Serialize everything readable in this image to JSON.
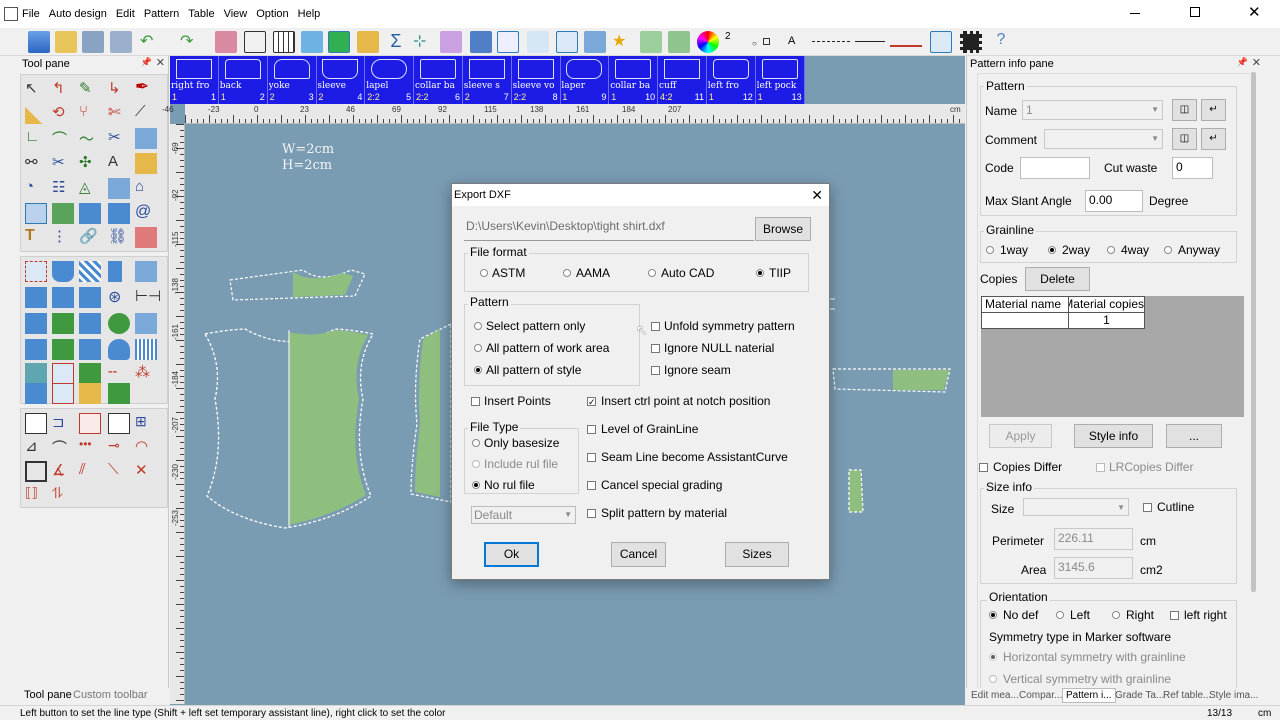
{
  "menu": [
    "File",
    "Auto design",
    "Edit",
    "Pattern",
    "Table",
    "View",
    "Option",
    "Help"
  ],
  "toolbar": {
    "layer_value": "2",
    "A_label": "A"
  },
  "tool_pane": {
    "title": "Tool pane",
    "tabs": [
      "Tool pane",
      "Custom toolbar"
    ]
  },
  "pieces": [
    {
      "name": "right fro",
      "count": "1",
      "num": "1"
    },
    {
      "name": "back",
      "count": "1",
      "num": "2"
    },
    {
      "name": "yoke",
      "count": "2",
      "num": "3"
    },
    {
      "name": "sleeve",
      "count": "2",
      "num": "4"
    },
    {
      "name": "lapel",
      "count": "2:2",
      "num": "5"
    },
    {
      "name": "collar ba",
      "count": "2:2",
      "num": "6"
    },
    {
      "name": "sleeve s",
      "count": "2",
      "num": "7"
    },
    {
      "name": "sleeve vo",
      "count": "2:2",
      "num": "8"
    },
    {
      "name": "laper",
      "count": "1",
      "num": "9"
    },
    {
      "name": "collar ba",
      "count": "1",
      "num": "10"
    },
    {
      "name": "cuff",
      "count": "4:2",
      "num": "11"
    },
    {
      "name": "left fro",
      "count": "1",
      "num": "12"
    },
    {
      "name": "left pock",
      "count": "1",
      "num": "13"
    }
  ],
  "ruler_h": [
    "-46",
    "-23",
    "0",
    "23",
    "46",
    "69",
    "92",
    "115",
    "138",
    "161",
    "184",
    "207"
  ],
  "ruler_v": [
    "-69",
    "-92",
    "-115",
    "-138",
    "-161",
    "-184",
    "-207",
    "-230",
    "-253"
  ],
  "ruler_unit": "cm",
  "work_area": {
    "w_label": "W=2cm",
    "h_label": "H=2cm"
  },
  "dialog": {
    "title": "Export DXF",
    "path": "D:\\Users\\Kevin\\Desktop\\tight shirt.dxf",
    "browse": "Browse",
    "file_format_title": "File format",
    "formats": [
      {
        "label": "ASTM",
        "selected": false
      },
      {
        "label": "AAMA",
        "selected": false
      },
      {
        "label": "Auto CAD",
        "selected": false
      },
      {
        "label": "TIIP",
        "selected": true
      }
    ],
    "pattern_title": "Pattern",
    "pattern_opts": [
      {
        "label": "Select pattern only",
        "selected": false
      },
      {
        "label": "All pattern of work area",
        "selected": false
      },
      {
        "label": "All pattern of style",
        "selected": true
      }
    ],
    "right_checks": [
      {
        "label": "Unfold symmetry pattern",
        "checked": false
      },
      {
        "label": "Ignore NULL naterial",
        "checked": false
      },
      {
        "label": "Ignore seam",
        "checked": false
      }
    ],
    "insert_points": {
      "label": "Insert Points",
      "checked": false
    },
    "insert_ctrl": {
      "label": "Insert ctrl point at notch position",
      "checked": true
    },
    "file_type_title": "File Type",
    "file_types": [
      {
        "label": "Only basesize",
        "selected": false,
        "disabled": false
      },
      {
        "label": "Include rul file",
        "selected": false,
        "disabled": true
      },
      {
        "label": "No rul file",
        "selected": true,
        "disabled": false
      }
    ],
    "lower_checks": [
      {
        "label": "Level of GrainLine",
        "checked": false
      },
      {
        "label": "Seam Line become  AssistantCurve",
        "checked": false
      },
      {
        "label": "Cancel special grading",
        "checked": false
      },
      {
        "label": "Split pattern by material",
        "checked": false
      }
    ],
    "default_select": "Default",
    "ok": "Ok",
    "cancel": "Cancel",
    "sizes": "Sizes"
  },
  "info_pane": {
    "title": "Pattern info pane",
    "pattern_section": "Pattern",
    "name_label": "Name",
    "name_value": "1",
    "comment_label": "Comment",
    "code_label": "Code",
    "cut_waste_label": "Cut waste",
    "cut_waste_value": "0",
    "max_slant_label": "Max Slant Angle",
    "max_slant_value": "0.00",
    "degree_label": "Degree",
    "grainline_title": "Grainline",
    "grainline_opts": [
      {
        "label": "1way",
        "selected": false
      },
      {
        "label": "2way",
        "selected": true
      },
      {
        "label": "4way",
        "selected": false
      },
      {
        "label": "Anyway",
        "selected": false
      }
    ],
    "copies_label": "Copies",
    "delete_btn": "Delete",
    "table_headers": [
      "Material name",
      "Material copies"
    ],
    "table_row": [
      "",
      "1"
    ],
    "apply_btn": "Apply",
    "style_info_btn": "Style info",
    "more_btn": "...",
    "copies_differ": "Copies Differ",
    "lr_copies_differ": "LRCopies Differ",
    "size_info_title": "Size info",
    "size_label": "Size",
    "cutline_label": "Cutline",
    "perimeter_label": "Perimeter",
    "perimeter_value": "226.11",
    "perimeter_unit": "cm",
    "area_label": "Area",
    "area_value": "3145.6",
    "area_unit": "cm2",
    "orientation_title": "Orientation",
    "orientation_opts": [
      {
        "label": "No def",
        "selected": true
      },
      {
        "label": "Left",
        "selected": false
      },
      {
        "label": "Right",
        "selected": false
      }
    ],
    "left_right_label": "left right",
    "symmetry_label": "Symmetry type in Marker software",
    "symmetry_opts": [
      "Horizontal symmetry with grainline",
      "Vertical symmetry with grainline"
    ],
    "tabs": [
      "Edit mea...",
      "Compar...",
      "Pattern i...",
      "Grade Ta...",
      "Ref table...",
      "Style ima..."
    ]
  },
  "status": {
    "message": "Left button to set the line type (Shift + left set temporary assistant line), right click to set the color",
    "right": "13/13",
    "unit": "cm"
  },
  "colors": {
    "piece_strip": "#1c1ce6",
    "work_bg": "#7a9cb3",
    "piece_fill": "#8fbf7f",
    "accent": "#0078d7"
  }
}
